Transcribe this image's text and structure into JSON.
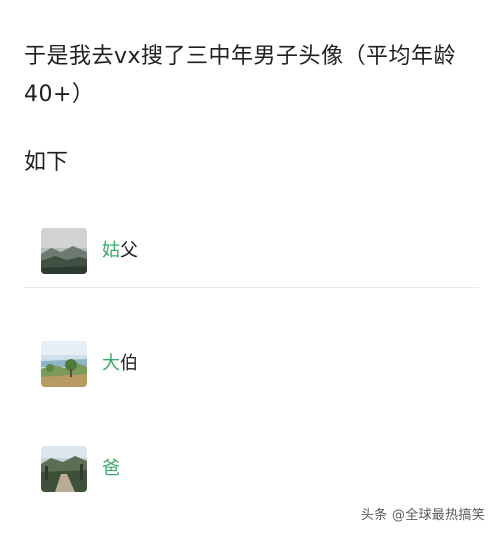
{
  "post": {
    "intro": "于是我去vx搜了三中年男子头像（平均年龄40+）",
    "subhead": "如下"
  },
  "contacts": [
    {
      "highlight": "姑",
      "rest": "父",
      "avatar": "misty-mountain-landscape"
    },
    {
      "highlight": "大",
      "rest": "伯",
      "avatar": "coastal-trees-landscape"
    },
    {
      "highlight": "爸",
      "rest": "",
      "avatar": "stone-path-mountain-landscape"
    }
  ],
  "colors": {
    "highlight": "#3aa86b",
    "text": "#1f1f1f",
    "divider": "#e9e9e9"
  },
  "watermark": "头条 @全球最热搞笑"
}
